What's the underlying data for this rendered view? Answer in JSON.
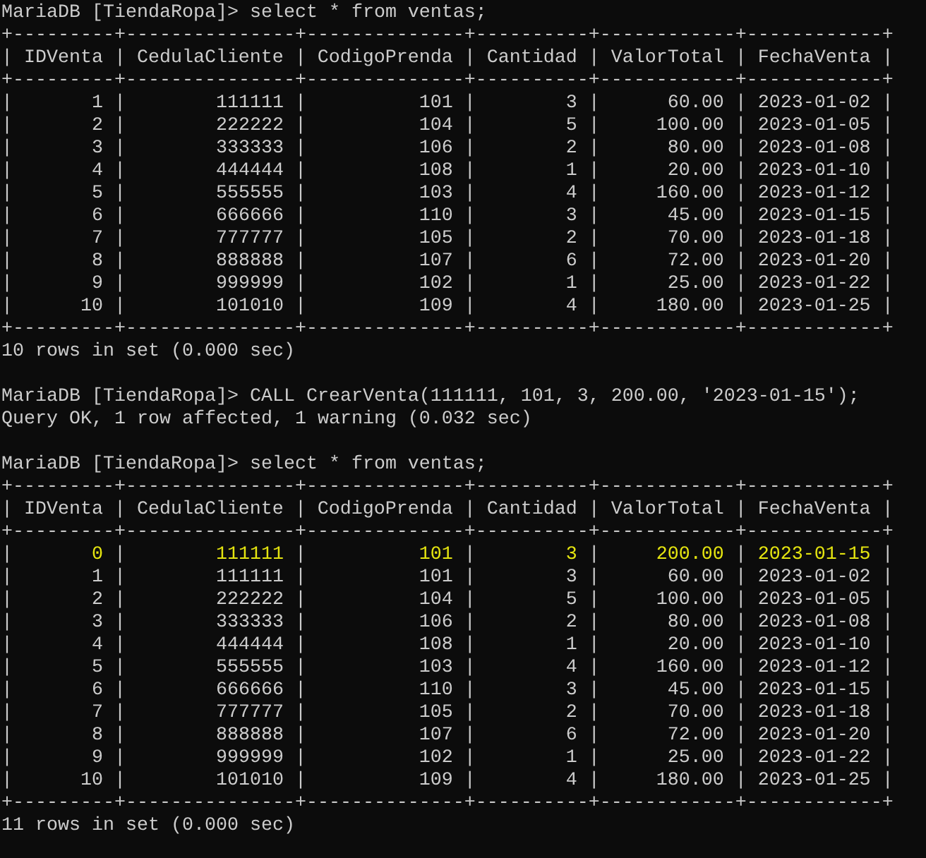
{
  "blocks": [
    {
      "kind": "command",
      "text": "MariaDB [TiendaRopa]> select * from ventas;"
    },
    {
      "kind": "table",
      "separator": "|",
      "top_rule": "+---------+---------------+--------------+----------+------------+------------+",
      "header_rule": "+---------+---------------+--------------+----------+------------+------------+",
      "bottom_rule": "+---------+---------------+--------------+----------+------------+------------+",
      "columns": [
        {
          "label": "IDVenta",
          "kind": "number"
        },
        {
          "label": "CedulaCliente",
          "kind": "number"
        },
        {
          "label": "CodigoPrenda",
          "kind": "number"
        },
        {
          "label": "Cantidad",
          "kind": "number"
        },
        {
          "label": "ValorTotal",
          "kind": "number"
        },
        {
          "label": "FechaVenta",
          "kind": "text"
        }
      ],
      "rows": [
        {
          "highlighted": false,
          "cells": [
            "1",
            "111111",
            "101",
            "3",
            "60.00",
            "2023-01-02"
          ]
        },
        {
          "highlighted": false,
          "cells": [
            "2",
            "222222",
            "104",
            "5",
            "100.00",
            "2023-01-05"
          ]
        },
        {
          "highlighted": false,
          "cells": [
            "3",
            "333333",
            "106",
            "2",
            "80.00",
            "2023-01-08"
          ]
        },
        {
          "highlighted": false,
          "cells": [
            "4",
            "444444",
            "108",
            "1",
            "20.00",
            "2023-01-10"
          ]
        },
        {
          "highlighted": false,
          "cells": [
            "5",
            "555555",
            "103",
            "4",
            "160.00",
            "2023-01-12"
          ]
        },
        {
          "highlighted": false,
          "cells": [
            "6",
            "666666",
            "110",
            "3",
            "45.00",
            "2023-01-15"
          ]
        },
        {
          "highlighted": false,
          "cells": [
            "7",
            "777777",
            "105",
            "2",
            "70.00",
            "2023-01-18"
          ]
        },
        {
          "highlighted": false,
          "cells": [
            "8",
            "888888",
            "107",
            "6",
            "72.00",
            "2023-01-20"
          ]
        },
        {
          "highlighted": false,
          "cells": [
            "9",
            "999999",
            "102",
            "1",
            "25.00",
            "2023-01-22"
          ]
        },
        {
          "highlighted": false,
          "cells": [
            "10",
            "101010",
            "109",
            "4",
            "180.00",
            "2023-01-25"
          ]
        }
      ]
    },
    {
      "kind": "message",
      "text": "10 rows in set (0.000 sec)"
    },
    {
      "kind": "blank"
    },
    {
      "kind": "command",
      "text": "MariaDB [TiendaRopa]> CALL CrearVenta(111111, 101, 3, 200.00, '2023-01-15');"
    },
    {
      "kind": "message",
      "text": "Query OK, 1 row affected, 1 warning (0.032 sec)"
    },
    {
      "kind": "blank"
    },
    {
      "kind": "command",
      "text": "MariaDB [TiendaRopa]> select * from ventas;"
    },
    {
      "kind": "table",
      "separator": "|",
      "top_rule": "+---------+---------------+--------------+----------+------------+------------+",
      "header_rule": "+---------+---------------+--------------+----------+------------+------------+",
      "bottom_rule": "+---------+---------------+--------------+----------+------------+------------+",
      "columns": [
        {
          "label": "IDVenta",
          "kind": "number"
        },
        {
          "label": "CedulaCliente",
          "kind": "number"
        },
        {
          "label": "CodigoPrenda",
          "kind": "number"
        },
        {
          "label": "Cantidad",
          "kind": "number"
        },
        {
          "label": "ValorTotal",
          "kind": "number"
        },
        {
          "label": "FechaVenta",
          "kind": "text"
        }
      ],
      "rows": [
        {
          "highlighted": true,
          "cells": [
            "0",
            "111111",
            "101",
            "3",
            "200.00",
            "2023-01-15"
          ]
        },
        {
          "highlighted": false,
          "cells": [
            "1",
            "111111",
            "101",
            "3",
            "60.00",
            "2023-01-02"
          ]
        },
        {
          "highlighted": false,
          "cells": [
            "2",
            "222222",
            "104",
            "5",
            "100.00",
            "2023-01-05"
          ]
        },
        {
          "highlighted": false,
          "cells": [
            "3",
            "333333",
            "106",
            "2",
            "80.00",
            "2023-01-08"
          ]
        },
        {
          "highlighted": false,
          "cells": [
            "4",
            "444444",
            "108",
            "1",
            "20.00",
            "2023-01-10"
          ]
        },
        {
          "highlighted": false,
          "cells": [
            "5",
            "555555",
            "103",
            "4",
            "160.00",
            "2023-01-12"
          ]
        },
        {
          "highlighted": false,
          "cells": [
            "6",
            "666666",
            "110",
            "3",
            "45.00",
            "2023-01-15"
          ]
        },
        {
          "highlighted": false,
          "cells": [
            "7",
            "777777",
            "105",
            "2",
            "70.00",
            "2023-01-18"
          ]
        },
        {
          "highlighted": false,
          "cells": [
            "8",
            "888888",
            "107",
            "6",
            "72.00",
            "2023-01-20"
          ]
        },
        {
          "highlighted": false,
          "cells": [
            "9",
            "999999",
            "102",
            "1",
            "25.00",
            "2023-01-22"
          ]
        },
        {
          "highlighted": false,
          "cells": [
            "10",
            "101010",
            "109",
            "4",
            "180.00",
            "2023-01-25"
          ]
        }
      ]
    },
    {
      "kind": "message",
      "text": "11 rows in set (0.000 sec)"
    }
  ]
}
